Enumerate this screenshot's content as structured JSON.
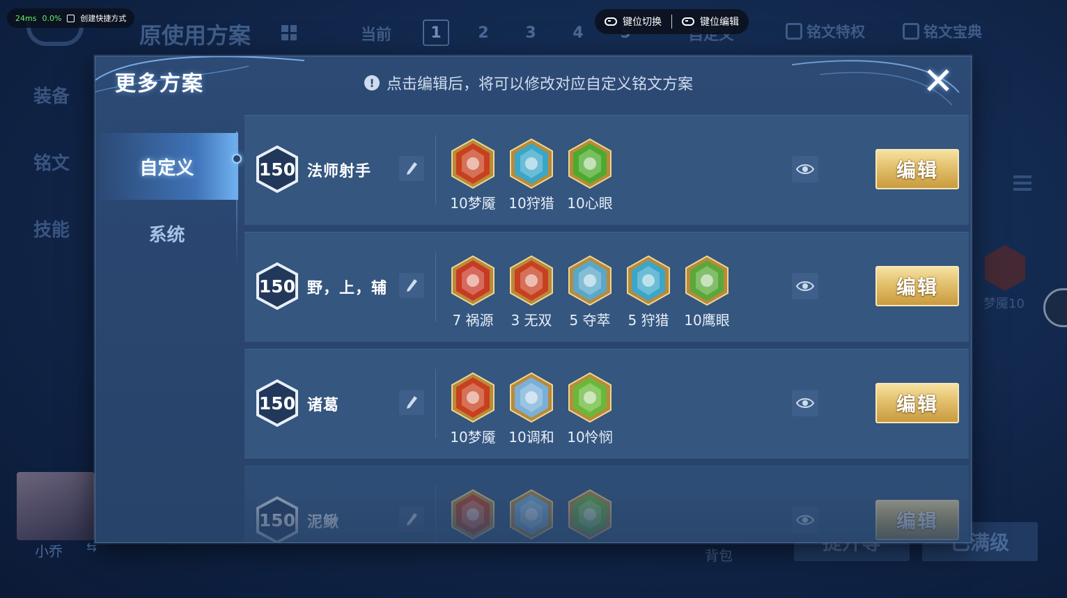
{
  "background": {
    "title": "原使用方案",
    "current_label": "当前",
    "pages": [
      "1",
      "2",
      "3",
      "4",
      "5"
    ],
    "custom_tab": "自定义",
    "rune_privilege": "铭文特权",
    "rune_guide": "铭文宝典",
    "side_nav": [
      "装备",
      "铭文",
      "技能"
    ],
    "right_rune_label": "梦魇10",
    "hero_name": "小乔",
    "swap_glyph": "⇆",
    "bag_label": "背包",
    "upgrade_button": "提升等",
    "max_level_button": "已满级"
  },
  "perf": {
    "latency": "24ms",
    "loss": "0.0%",
    "shortcut_label": "创建快捷方式"
  },
  "keybar": {
    "switch_label": "键位切换",
    "edit_label": "键位编辑"
  },
  "modal": {
    "title": "更多方案",
    "notice": "点击编辑后，将可以修改对应自定义铭文方案",
    "notice_icon": "!",
    "close_glyph": "✕",
    "tabs": [
      {
        "label": "自定义",
        "active": true
      },
      {
        "label": "系统",
        "active": false
      }
    ],
    "edit_label": "编辑",
    "schemes": [
      {
        "level": "150",
        "name": "法师射手",
        "runes": [
          {
            "label": "10梦魇",
            "color": "#c8401e",
            "icon": "nightmare-rune-icon"
          },
          {
            "label": "10狩猎",
            "color": "#3aa6c8",
            "icon": "hunt-rune-icon"
          },
          {
            "label": "10心眼",
            "color": "#4caa2e",
            "icon": "mind-eye-rune-icon"
          }
        ]
      },
      {
        "level": "150",
        "name": "野，上，辅",
        "runes": [
          {
            "label": "7 祸源",
            "color": "#c83a24",
            "icon": "calamity-rune-icon"
          },
          {
            "label": "3 无双",
            "color": "#c84020",
            "icon": "peerless-rune-icon"
          },
          {
            "label": "5 夺萃",
            "color": "#5aa8c8",
            "icon": "extract-rune-icon"
          },
          {
            "label": "5 狩猎",
            "color": "#3aa6c8",
            "icon": "hunt-rune-icon"
          },
          {
            "label": "10鹰眼",
            "color": "#5aa83a",
            "icon": "hawk-eye-rune-icon"
          }
        ]
      },
      {
        "level": "150",
        "name": "诸葛",
        "runes": [
          {
            "label": "10梦魇",
            "color": "#c8401e",
            "icon": "nightmare-rune-icon"
          },
          {
            "label": "10调和",
            "color": "#7ab0d8",
            "icon": "harmony-rune-icon"
          },
          {
            "label": "10怜悯",
            "color": "#6ab83a",
            "icon": "mercy-rune-icon"
          }
        ]
      },
      {
        "level": "150",
        "name": "泥鳅",
        "runes": [
          {
            "label": "",
            "color": "#c8401e",
            "icon": "nightmare-rune-icon"
          },
          {
            "label": "",
            "color": "#7ab0d8",
            "icon": "harmony-rune-icon"
          },
          {
            "label": "",
            "color": "#6ab83a",
            "icon": "mercy-rune-icon"
          }
        ]
      }
    ]
  },
  "colors": {
    "gold": "#e2c06c",
    "panel": "#2c4a74",
    "row": "#34567f",
    "accent": "#7fc3ff"
  }
}
